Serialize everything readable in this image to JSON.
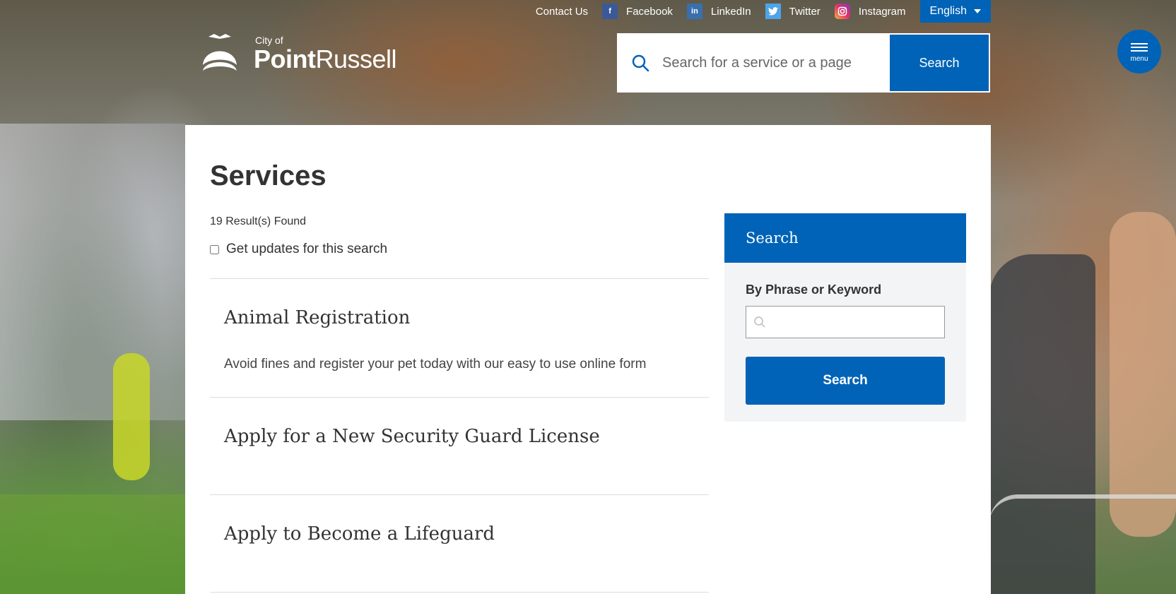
{
  "topbar": {
    "contact": "Contact Us",
    "facebook": "Facebook",
    "linkedin": "LinkedIn",
    "twitter": "Twitter",
    "instagram": "Instagram",
    "language": "English"
  },
  "logo": {
    "city_of": "City of",
    "name_bold": "Point",
    "name_light": "Russell"
  },
  "header_search": {
    "placeholder": "Search for a service or a page",
    "button": "Search"
  },
  "menu": {
    "label": "menu"
  },
  "page": {
    "title": "Services",
    "results_count": "19 Result(s) Found",
    "updates_label": "Get updates for this search"
  },
  "results": [
    {
      "title": "Animal Registration",
      "description": "Avoid fines and register your pet today with our easy to use online form"
    },
    {
      "title": "Apply for a New Security Guard License",
      "description": ""
    },
    {
      "title": "Apply to Become a Lifeguard",
      "description": ""
    }
  ],
  "sidebar": {
    "heading": "Search",
    "keyword_label": "By Phrase or Keyword",
    "keyword_value": "",
    "button": "Search"
  },
  "colors": {
    "primary": "#0063b7",
    "text": "#333333"
  }
}
